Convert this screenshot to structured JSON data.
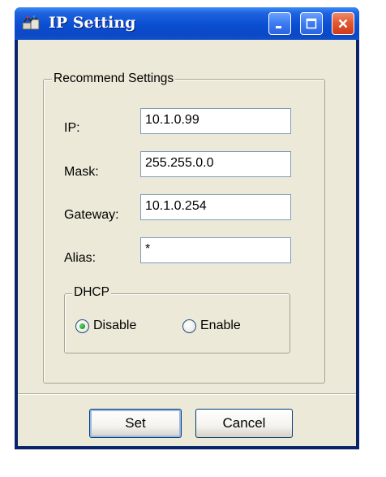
{
  "window": {
    "title": "IP Setting",
    "controls": [
      "minimize-icon",
      "maximize-icon",
      "close-icon"
    ]
  },
  "recommend_group": {
    "legend": "Recommend Settings",
    "fields": [
      {
        "label": "IP:",
        "value": "10.1.0.99"
      },
      {
        "label": "Mask:",
        "value": "255.255.0.0"
      },
      {
        "label": "Gateway:",
        "value": "10.1.0.254"
      },
      {
        "label": "Alias:",
        "value": "*"
      }
    ]
  },
  "dhcp_group": {
    "legend": "DHCP",
    "options": [
      {
        "label": "Disable",
        "selected": true
      },
      {
        "label": "Enable",
        "selected": false
      }
    ]
  },
  "buttons": {
    "set_label": "Set",
    "cancel_label": "Cancel"
  },
  "colors": {
    "titlebar": "#0b4ed2",
    "client": "#ece9d8",
    "close_button": "#e35a32",
    "radio_dot": "#21a121"
  }
}
